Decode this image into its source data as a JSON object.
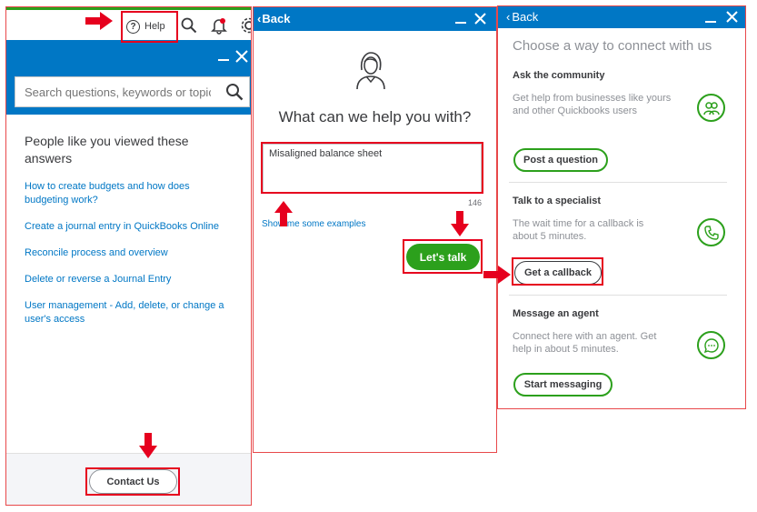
{
  "panel1": {
    "help_label": "Help",
    "search_placeholder": "Search questions, keywords or topics",
    "section_title": "People like you viewed these answers",
    "links": [
      "How to create budgets and how does budgeting work?",
      "Create a journal entry in QuickBooks Online",
      "Reconcile process and overview",
      "Delete or reverse a Journal Entry",
      "User management - Add, delete, or change a user's access"
    ],
    "contact_label": "Contact Us"
  },
  "panel2": {
    "back_label": "Back",
    "title": "What can we help you with?",
    "input_value": "Misaligned balance sheet",
    "char_count": "146",
    "examples_link": "Show me some examples",
    "lets_talk_label": "Let's talk"
  },
  "panel3": {
    "back_label": "Back",
    "title": "Choose a way to connect with us",
    "sections": [
      {
        "title": "Ask the community",
        "desc": "Get help from businesses like yours and other Quickbooks users",
        "button": "Post a question",
        "icon": "community-icon"
      },
      {
        "title": "Talk to a specialist",
        "desc": "The wait time for a callback is about 5 minutes.",
        "button": "Get a callback",
        "icon": "phone-icon"
      },
      {
        "title": "Message an agent",
        "desc": "Connect here with an agent. Get help in about 5 minutes.",
        "button": "Start messaging",
        "icon": "chat-icon"
      }
    ]
  },
  "colors": {
    "brand_blue": "#0077c5",
    "brand_green": "#2ca01c",
    "annotation_red": "#e6001e"
  }
}
